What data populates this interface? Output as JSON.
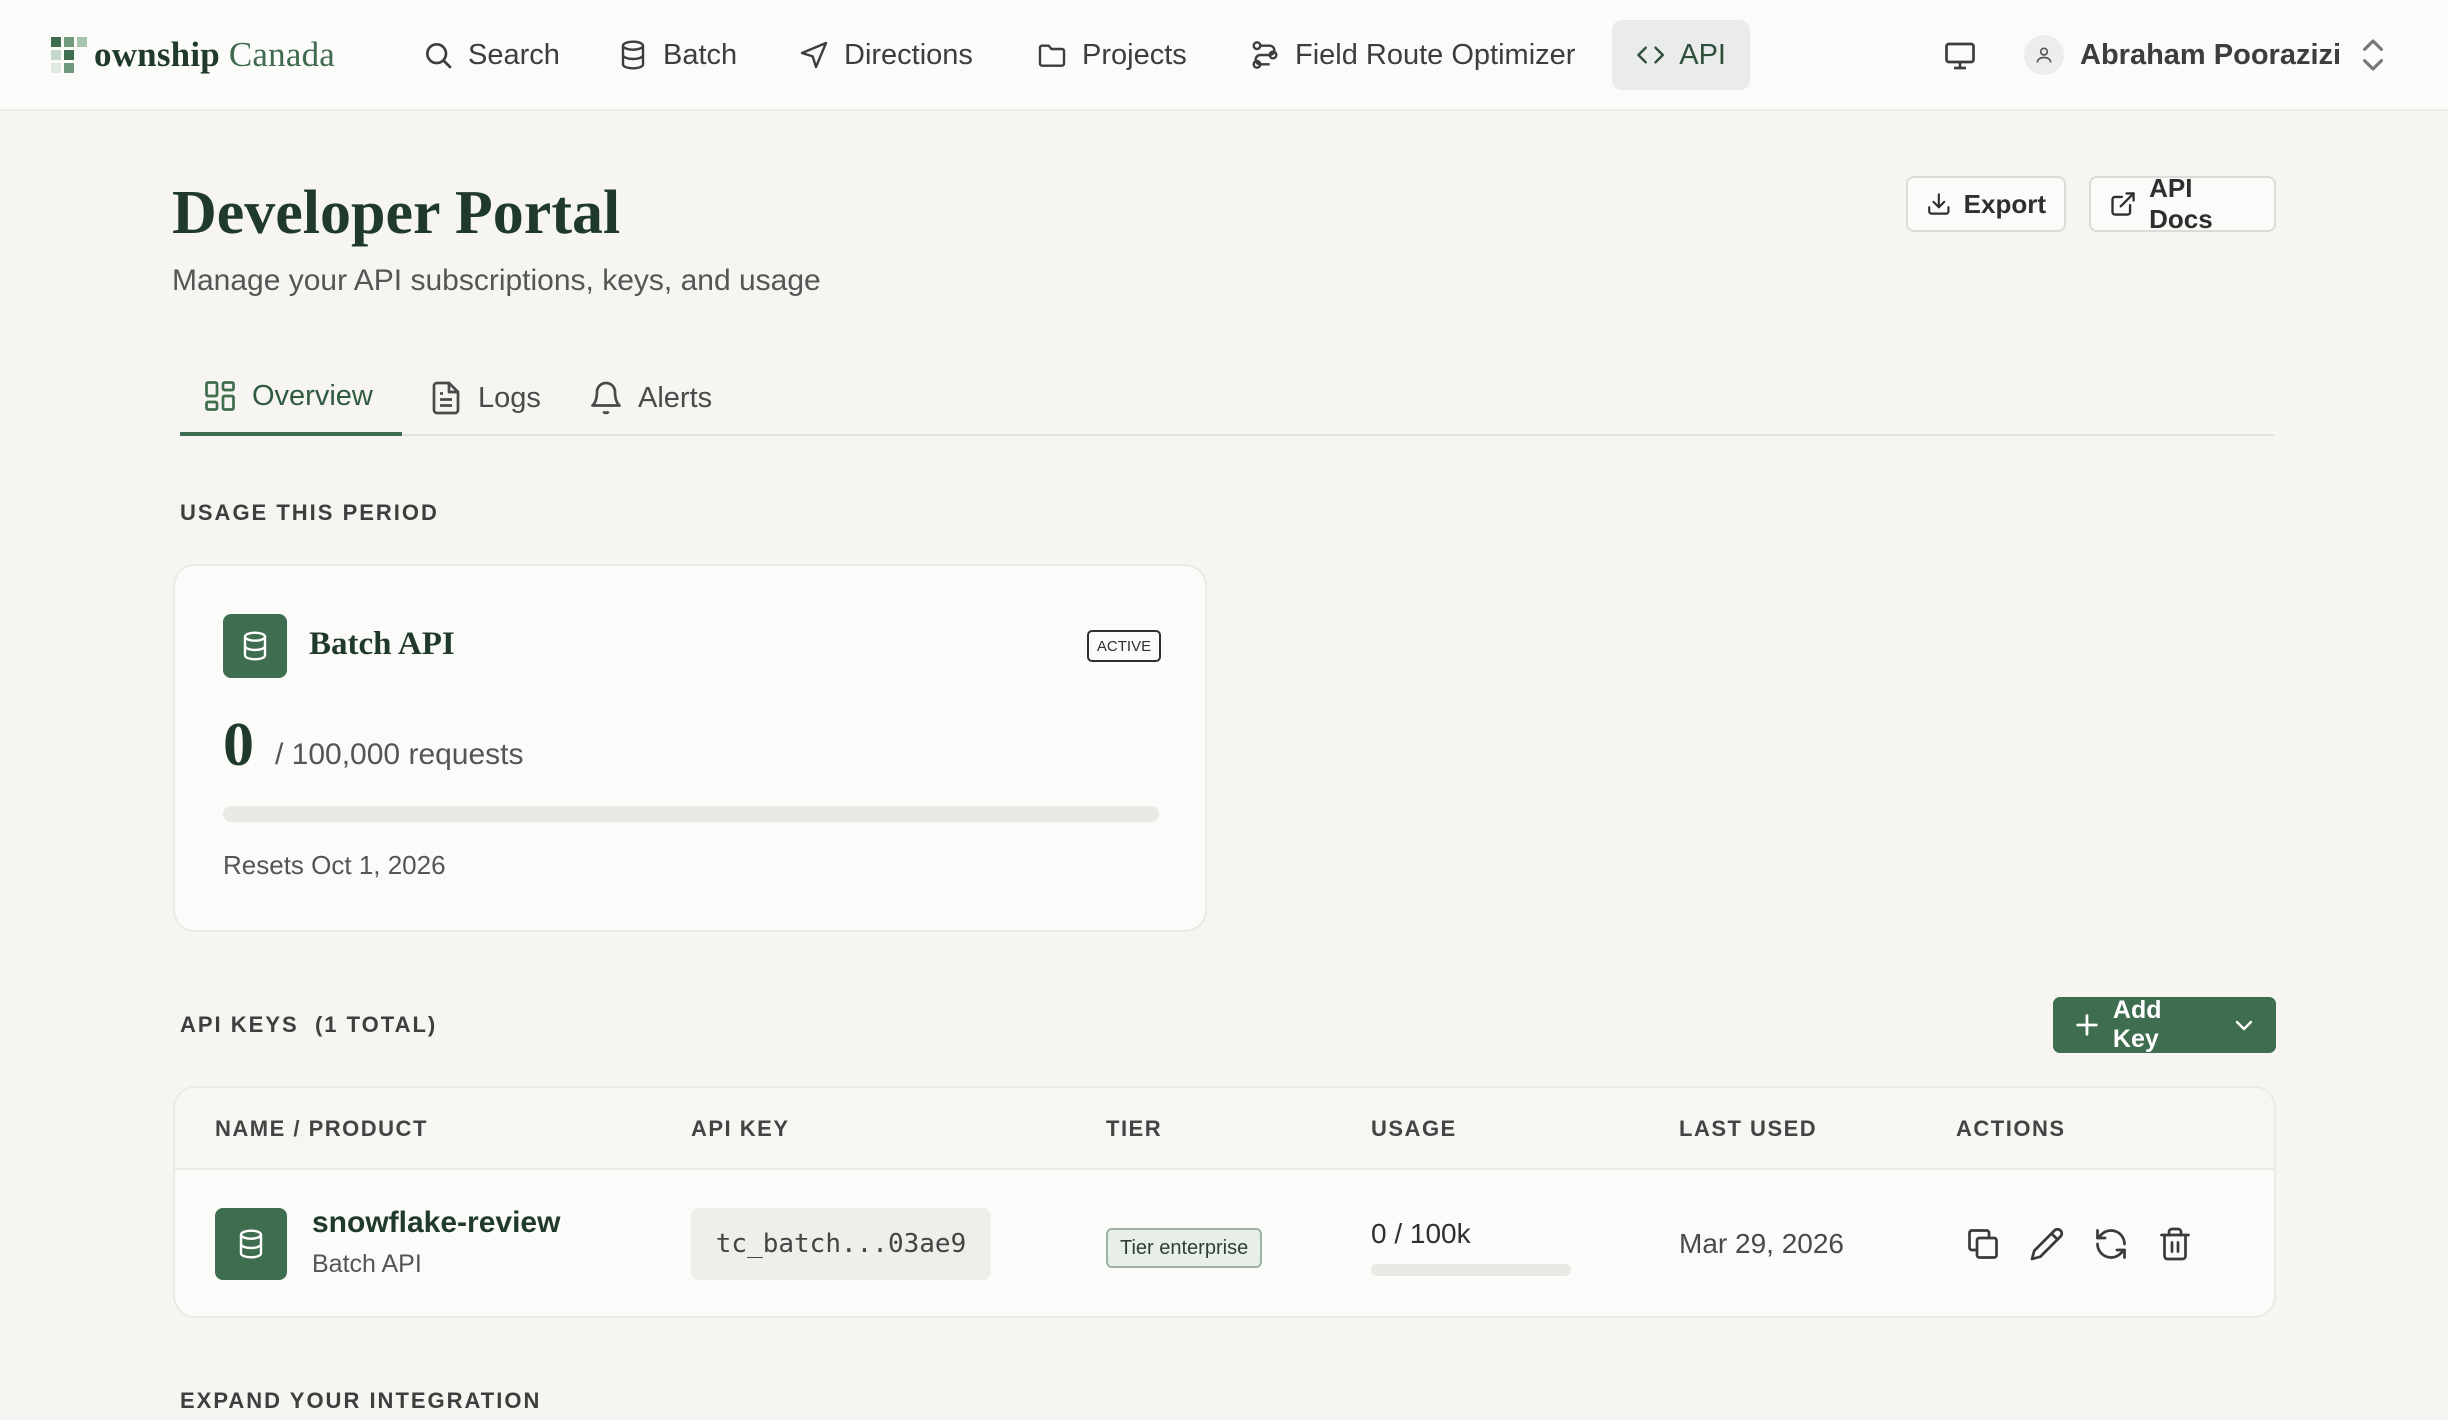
{
  "nav": {
    "logo": {
      "bold": "ownship",
      "rest": " Canada"
    },
    "items": [
      {
        "label": "Search",
        "icon": "search-icon"
      },
      {
        "label": "Batch",
        "icon": "database-icon"
      },
      {
        "label": "Directions",
        "icon": "navigation-icon"
      },
      {
        "label": "Projects",
        "icon": "folder-icon"
      },
      {
        "label": "Field Route Optimizer",
        "icon": "route-icon"
      },
      {
        "label": "API",
        "icon": "code-icon",
        "active": true
      }
    ],
    "user": {
      "name": "Abraham Poorazizi"
    }
  },
  "header": {
    "title": "Developer Portal",
    "subtitle": "Manage your API subscriptions, keys, and usage",
    "export_label": "Export",
    "apidocs_label": "API Docs"
  },
  "tabs": [
    {
      "label": "Overview",
      "active": true
    },
    {
      "label": "Logs"
    },
    {
      "label": "Alerts"
    }
  ],
  "usage": {
    "section_label": "USAGE THIS PERIOD",
    "product": "Batch API",
    "status": "ACTIVE",
    "used": "0",
    "limit_text": "/ 100,000 requests",
    "progress_fraction": 0,
    "resets": "Resets Oct 1, 2026"
  },
  "api_keys": {
    "section_label": "API KEYS",
    "count_label": "(1 TOTAL)",
    "add_label": "Add Key",
    "columns": [
      "NAME / PRODUCT",
      "API KEY",
      "TIER",
      "USAGE",
      "LAST USED",
      "ACTIONS"
    ],
    "rows": [
      {
        "name": "snowflake-review",
        "product": "Batch API",
        "key": "tc_batch...03ae9",
        "tier": "Tier enterprise",
        "usage": "0 / 100k",
        "usage_fraction": 0,
        "last_used": "Mar 29, 2026"
      }
    ]
  },
  "expand": {
    "section_label": "EXPAND YOUR INTEGRATION"
  },
  "colors": {
    "accent": "#3f6d4f",
    "title": "#1f3a2a",
    "background": "#f6f5f1"
  }
}
